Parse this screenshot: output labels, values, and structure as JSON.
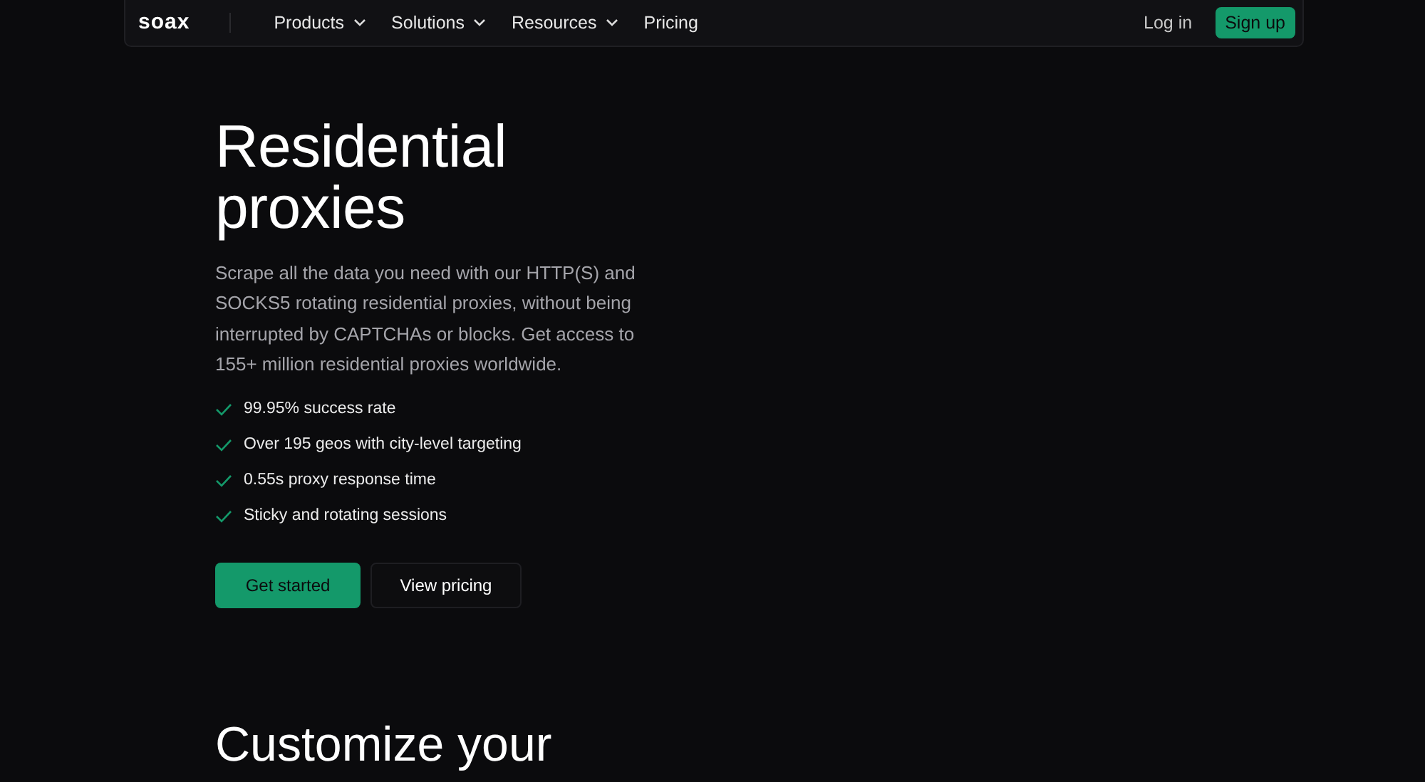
{
  "nav": {
    "logo": "soax",
    "menu": [
      {
        "label": "Products",
        "dropdown": true
      },
      {
        "label": "Solutions",
        "dropdown": true
      },
      {
        "label": "Resources",
        "dropdown": true
      },
      {
        "label": "Pricing",
        "dropdown": false
      }
    ],
    "login": "Log in",
    "signup": "Sign up"
  },
  "hero": {
    "title": "Residential proxies",
    "description": "Scrape all the data you need with our HTTP(S) and SOCKS5 rotating residential proxies, without being interrupted by CAPTCHAs or blocks. Get access to 155+ million residential proxies worldwide.",
    "features": [
      "99.95% success rate",
      "Over 195 geos with city-level targeting",
      "0.55s proxy response time",
      "Sticky and rotating sessions"
    ],
    "primary_button": "Get started",
    "secondary_button": "View pricing"
  },
  "next_section": {
    "title": "Customize your"
  }
}
